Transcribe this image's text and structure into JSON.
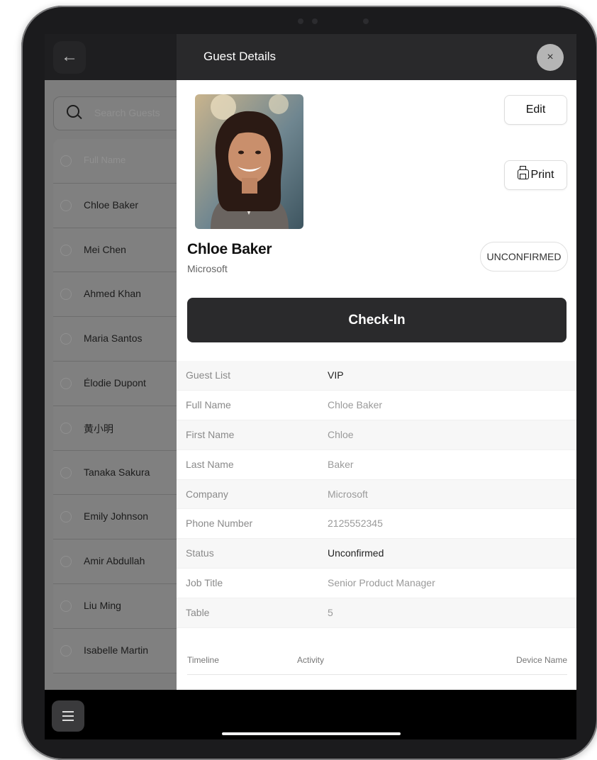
{
  "left_pane": {
    "search_placeholder": "Search Guests",
    "list_header": "Full Name",
    "guests": [
      "Chloe Baker",
      "Mei Chen",
      "Ahmed Khan",
      "Maria Santos",
      "Élodie Dupont",
      "黄小明",
      "Tanaka Sakura",
      "Emily Johnson",
      "Amir Abdullah",
      "Liu Ming",
      "Isabelle Martin"
    ]
  },
  "panel": {
    "title": "Guest Details",
    "close_label": "×",
    "edit_label": "Edit",
    "print_label": "Print",
    "guest_name": "Chloe Baker",
    "guest_company": "Microsoft",
    "status_badge": "UNCONFIRMED",
    "checkin_label": "Check-In",
    "details": [
      {
        "label": "Guest List",
        "value": "VIP"
      },
      {
        "label": "Full Name",
        "value": "Chloe Baker"
      },
      {
        "label": "First Name",
        "value": "Chloe"
      },
      {
        "label": "Last Name",
        "value": "Baker"
      },
      {
        "label": "Company",
        "value": "Microsoft"
      },
      {
        "label": "Phone Number",
        "value": "2125552345"
      },
      {
        "label": "Status",
        "value": "Unconfirmed"
      },
      {
        "label": "Job Title",
        "value": "Senior Product Manager"
      },
      {
        "label": "Table",
        "value": "5"
      }
    ],
    "timeline_headers": {
      "timeline": "Timeline",
      "activity": "Activity",
      "device": "Device Name"
    }
  },
  "icons": {
    "back": "arrow-left-icon",
    "search": "search-icon",
    "close": "close-icon",
    "print": "printer-icon",
    "menu": "hamburger-menu-icon"
  },
  "colors": {
    "header_dark": "#29292b",
    "checkin_button": "#2a2a2c",
    "dim_overlay": "#7d7d7d",
    "device_frame": "#1b1b1d"
  }
}
